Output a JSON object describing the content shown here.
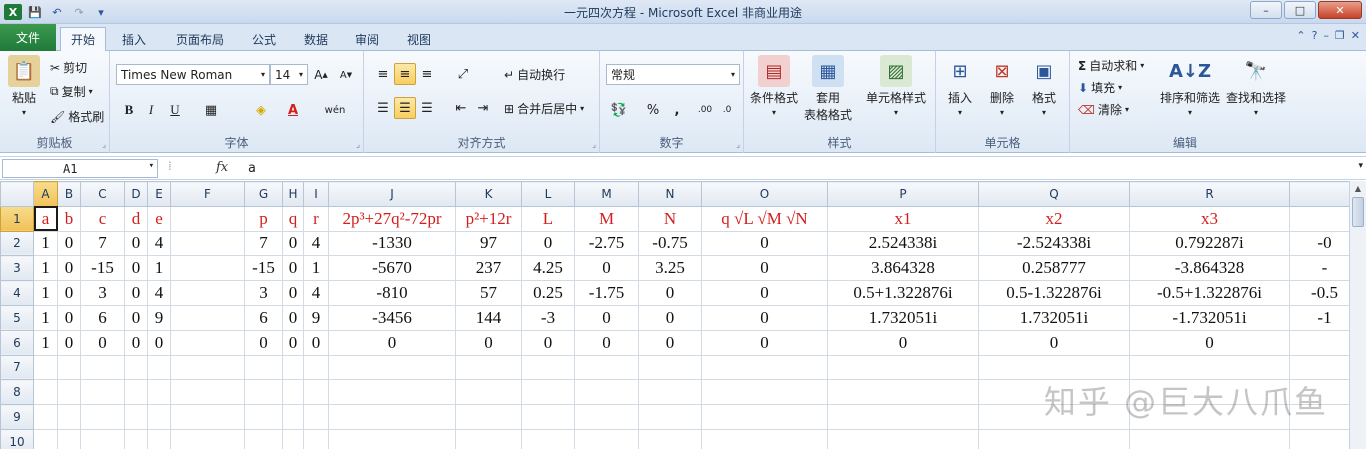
{
  "window": {
    "title": "一元四次方程 - Microsoft Excel 非商业用途",
    "minimize": "–",
    "maximize": "□",
    "close": "✕"
  },
  "tabs": [
    "文件",
    "开始",
    "插入",
    "页面布局",
    "公式",
    "数据",
    "审阅",
    "视图"
  ],
  "ribbon": {
    "clipboard": {
      "paste": "粘贴",
      "cut": "剪切",
      "copy": "复制",
      "format_painter": "格式刷",
      "label": "剪贴板"
    },
    "font": {
      "name": "Times New Roman",
      "size": "14",
      "bold": "B",
      "italic": "I",
      "underline": "U",
      "label": "字体"
    },
    "alignment": {
      "wrap": "自动换行",
      "merge": "合并后居中",
      "label": "对齐方式"
    },
    "number": {
      "format": "常规",
      "percent": "%",
      "comma": ",",
      "label": "数字"
    },
    "styles": {
      "conditional": "条件格式",
      "table_line1": "套用",
      "table_line2": "表格格式",
      "cell_styles": "单元格样式",
      "label": "样式"
    },
    "cells": {
      "insert": "插入",
      "delete": "删除",
      "format": "格式",
      "label": "单元格"
    },
    "editing": {
      "autosum": "自动求和",
      "fill": "填充",
      "clear": "清除",
      "sort": "排序和筛选",
      "find": "查找和选择",
      "label": "编辑"
    }
  },
  "formula_bar": {
    "name_box": "A1",
    "fx": "fx",
    "value": "a"
  },
  "sheet": {
    "columns": [
      "A",
      "B",
      "C",
      "D",
      "E",
      "F",
      "G",
      "H",
      "I",
      "J",
      "K",
      "L",
      "M",
      "N",
      "O",
      "P",
      "Q",
      "R"
    ],
    "row_numbers": [
      "1",
      "2",
      "3",
      "4",
      "5",
      "6",
      "7",
      "8",
      "9",
      "10"
    ],
    "rows": [
      [
        "a",
        "b",
        "c",
        "d",
        "e",
        "",
        "p",
        "q",
        "r",
        "2p³+27q²-72pr",
        "p²+12r",
        "L",
        "M",
        "N",
        "q √L √M √N",
        "x1",
        "x2",
        "x3",
        ""
      ],
      [
        "1",
        "0",
        "7",
        "0",
        "4",
        "",
        "7",
        "0",
        "4",
        "-1330",
        "97",
        "0",
        "-2.75",
        "-0.75",
        "0",
        "2.524338i",
        "-2.524338i",
        "0.792287i",
        "-0"
      ],
      [
        "1",
        "0",
        "-15",
        "0",
        "1",
        "",
        "-15",
        "0",
        "1",
        "-5670",
        "237",
        "4.25",
        "0",
        "3.25",
        "0",
        "3.864328",
        "0.258777",
        "-3.864328",
        "-"
      ],
      [
        "1",
        "0",
        "3",
        "0",
        "4",
        "",
        "3",
        "0",
        "4",
        "-810",
        "57",
        "0.25",
        "-1.75",
        "0",
        "0",
        "0.5+1.322876i",
        "0.5-1.322876i",
        "-0.5+1.322876i",
        "-0.5"
      ],
      [
        "1",
        "0",
        "6",
        "0",
        "9",
        "",
        "6",
        "0",
        "9",
        "-3456",
        "144",
        "-3",
        "0",
        "0",
        "0",
        "1.732051i",
        "1.732051i",
        "-1.732051i",
        "-1"
      ],
      [
        "1",
        "0",
        "0",
        "0",
        "0",
        "",
        "0",
        "0",
        "0",
        "0",
        "0",
        "0",
        "0",
        "0",
        "0",
        "0",
        "0",
        "0",
        ""
      ],
      [
        "",
        "",
        "",
        "",
        "",
        "",
        "",
        "",
        "",
        "",
        "",
        "",
        "",
        "",
        "",
        "",
        "",
        "",
        ""
      ],
      [
        "",
        "",
        "",
        "",
        "",
        "",
        "",
        "",
        "",
        "",
        "",
        "",
        "",
        "",
        "",
        "",
        "",
        "",
        ""
      ],
      [
        "",
        "",
        "",
        "",
        "",
        "",
        "",
        "",
        "",
        "",
        "",
        "",
        "",
        "",
        "",
        "",
        "",
        "",
        ""
      ],
      [
        "",
        "",
        "",
        "",
        "",
        "",
        "",
        "",
        "",
        "",
        "",
        "",
        "",
        "",
        "",
        "",
        "",
        "",
        ""
      ]
    ]
  },
  "watermark": "知乎 @巨大八爪鱼",
  "colors": {
    "header_text": "#d41e1e",
    "file_tab": "#1f7a3a",
    "selection": "#f1c15a"
  }
}
